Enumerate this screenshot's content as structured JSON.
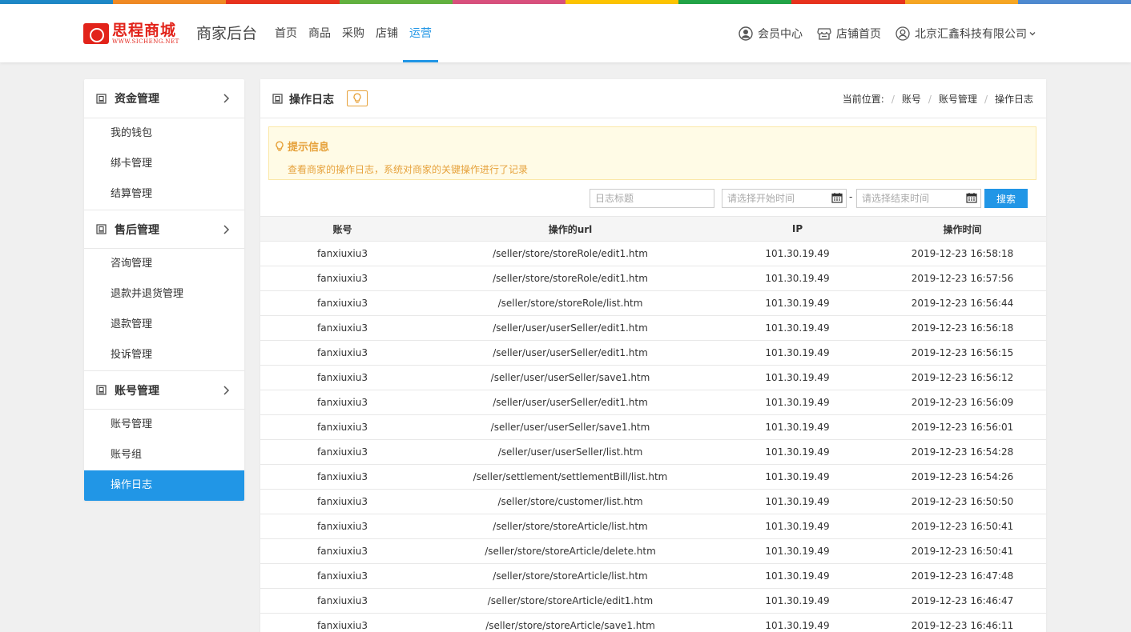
{
  "colors": {
    "strip": [
      "#1e88c7",
      "#f08a24",
      "#e8321e",
      "#62b13f",
      "#d9507d",
      "#fdc400",
      "#22a447",
      "#e8321e",
      "#f6a623",
      "#4e8ad0"
    ],
    "accent": "#2196e6",
    "tip": "#e6a23c"
  },
  "header": {
    "logo": {
      "name": "思程商城",
      "url": "WWW.SICHENG.NET"
    },
    "site_name": "商家后台",
    "nav": [
      {
        "label": "首页",
        "active": false
      },
      {
        "label": "商品",
        "active": false
      },
      {
        "label": "采购",
        "active": false
      },
      {
        "label": "店铺",
        "active": false
      },
      {
        "label": "运营",
        "active": true
      }
    ],
    "right": {
      "member_center": "会员中心",
      "shop_home": "店铺首页",
      "company": "北京汇鑫科技有限公司"
    }
  },
  "sidebar": {
    "groups": [
      {
        "title": "资金管理",
        "items": [
          {
            "label": "我的钱包",
            "active": false
          },
          {
            "label": "绑卡管理",
            "active": false
          },
          {
            "label": "结算管理",
            "active": false
          }
        ]
      },
      {
        "title": "售后管理",
        "items": [
          {
            "label": "咨询管理",
            "active": false
          },
          {
            "label": "退款并退货管理",
            "active": false
          },
          {
            "label": "退款管理",
            "active": false
          },
          {
            "label": "投诉管理",
            "active": false
          }
        ]
      },
      {
        "title": "账号管理",
        "items": [
          {
            "label": "账号管理",
            "active": false
          },
          {
            "label": "账号组",
            "active": false
          },
          {
            "label": "操作日志",
            "active": true
          }
        ]
      }
    ]
  },
  "panel": {
    "title": "操作日志",
    "breadcrumb": {
      "label": "当前位置:",
      "items": [
        "账号",
        "账号管理",
        "操作日志"
      ]
    },
    "tip": {
      "title": "提示信息",
      "text": "查看商家的操作日志，系统对商家的关键操作进行了记录"
    },
    "search": {
      "title_placeholder": "日志标题",
      "start_placeholder": "请选择开始时间",
      "end_placeholder": "请选择结束时间",
      "dash": "-",
      "button": "搜索"
    },
    "table": {
      "columns": [
        "账号",
        "操作的url",
        "IP",
        "操作时间"
      ],
      "rows": [
        [
          "fanxiuxiu3",
          "/seller/store/storeRole/edit1.htm",
          "101.30.19.49",
          "2019-12-23 16:58:18"
        ],
        [
          "fanxiuxiu3",
          "/seller/store/storeRole/edit1.htm",
          "101.30.19.49",
          "2019-12-23 16:57:56"
        ],
        [
          "fanxiuxiu3",
          "/seller/store/storeRole/list.htm",
          "101.30.19.49",
          "2019-12-23 16:56:44"
        ],
        [
          "fanxiuxiu3",
          "/seller/user/userSeller/edit1.htm",
          "101.30.19.49",
          "2019-12-23 16:56:18"
        ],
        [
          "fanxiuxiu3",
          "/seller/user/userSeller/edit1.htm",
          "101.30.19.49",
          "2019-12-23 16:56:15"
        ],
        [
          "fanxiuxiu3",
          "/seller/user/userSeller/save1.htm",
          "101.30.19.49",
          "2019-12-23 16:56:12"
        ],
        [
          "fanxiuxiu3",
          "/seller/user/userSeller/edit1.htm",
          "101.30.19.49",
          "2019-12-23 16:56:09"
        ],
        [
          "fanxiuxiu3",
          "/seller/user/userSeller/save1.htm",
          "101.30.19.49",
          "2019-12-23 16:56:01"
        ],
        [
          "fanxiuxiu3",
          "/seller/user/userSeller/list.htm",
          "101.30.19.49",
          "2019-12-23 16:54:28"
        ],
        [
          "fanxiuxiu3",
          "/seller/settlement/settlementBill/list.htm",
          "101.30.19.49",
          "2019-12-23 16:54:26"
        ],
        [
          "fanxiuxiu3",
          "/seller/store/customer/list.htm",
          "101.30.19.49",
          "2019-12-23 16:50:50"
        ],
        [
          "fanxiuxiu3",
          "/seller/store/storeArticle/list.htm",
          "101.30.19.49",
          "2019-12-23 16:50:41"
        ],
        [
          "fanxiuxiu3",
          "/seller/store/storeArticle/delete.htm",
          "101.30.19.49",
          "2019-12-23 16:50:41"
        ],
        [
          "fanxiuxiu3",
          "/seller/store/storeArticle/list.htm",
          "101.30.19.49",
          "2019-12-23 16:47:48"
        ],
        [
          "fanxiuxiu3",
          "/seller/store/storeArticle/edit1.htm",
          "101.30.19.49",
          "2019-12-23 16:46:47"
        ],
        [
          "fanxiuxiu3",
          "/seller/store/storeArticle/save1.htm",
          "101.30.19.49",
          "2019-12-23 16:46:11"
        ]
      ]
    }
  }
}
